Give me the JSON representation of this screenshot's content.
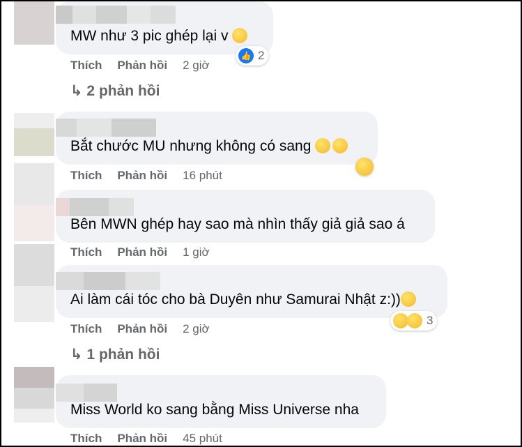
{
  "comments": [
    {
      "text": "MW như 3 pic ghép lại v",
      "like": "Thích",
      "reply": "Phản hồi",
      "time": "2 giờ",
      "reaction_count": "2"
    },
    {
      "text": "Bắt chước MU nhưng không có sang",
      "like": "Thích",
      "reply": "Phản hồi",
      "time": "16 phút"
    },
    {
      "text": "Bên MWN ghép hay sao mà nhìn thấy giả giả sao á",
      "like": "Thích",
      "reply": "Phản hồi",
      "time": "1 giờ"
    },
    {
      "text": "Ai làm cái tóc cho bà Duyên như Samurai Nhật z:))",
      "like": "Thích",
      "reply": "Phản hồi",
      "time": "2 giờ",
      "reaction_count": "3"
    },
    {
      "text": "Miss World ko sang bằng Miss Universe nha",
      "like": "Thích",
      "reply": "Phản hồi",
      "time": "45 phút"
    }
  ],
  "reply_links": [
    "↳ 2 phản hồi",
    "↳ 1 phản hồi"
  ],
  "colors": {
    "bubble": "#f0f2f5",
    "meta": "#65676b",
    "like_blue": "#1877f2"
  }
}
